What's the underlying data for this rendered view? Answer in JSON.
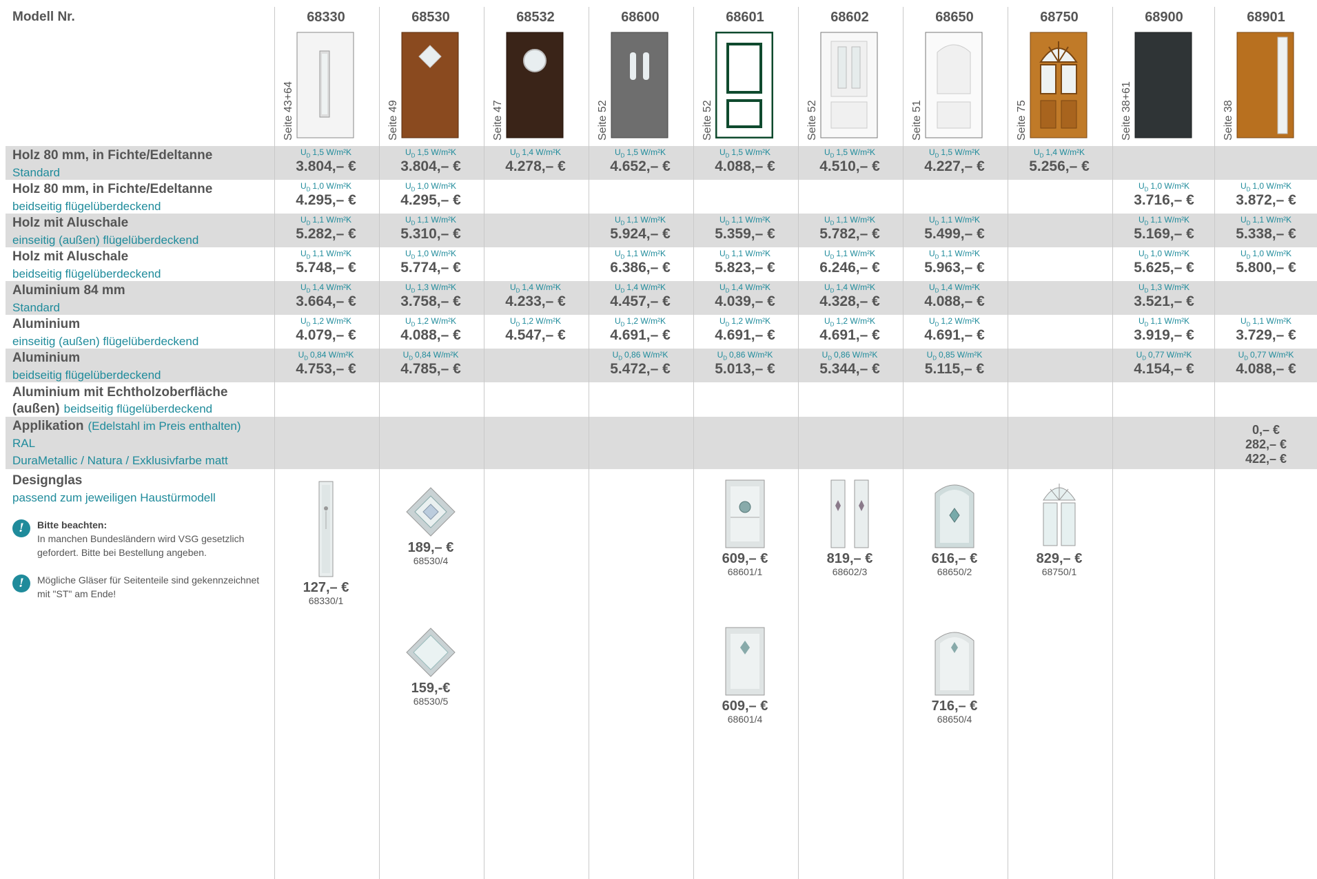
{
  "header": {
    "label": "Modell Nr.",
    "models": [
      {
        "no": "68330",
        "seite": "Seite 43+64",
        "door": "white-slim-glass"
      },
      {
        "no": "68530",
        "seite": "Seite 49",
        "door": "brown-diamond"
      },
      {
        "no": "68532",
        "seite": "Seite 47",
        "door": "darkbrown-round"
      },
      {
        "no": "68600",
        "seite": "Seite 52",
        "door": "grey-two-slots"
      },
      {
        "no": "68601",
        "seite": "Seite 52",
        "door": "green-frame-panels"
      },
      {
        "no": "68602",
        "seite": "Seite 52",
        "door": "white-panels"
      },
      {
        "no": "68650",
        "seite": "Seite 51",
        "door": "white-arch"
      },
      {
        "no": "68750",
        "seite": "Seite 75",
        "door": "wood-sunburst"
      },
      {
        "no": "68900",
        "seite": "Seite 38+61",
        "door": "anthracite"
      },
      {
        "no": "68901",
        "seite": "Seite 38",
        "door": "wood-sidelight"
      }
    ]
  },
  "rows": [
    {
      "title": "Holz 80 mm, in Fichte/Edeltanne",
      "subtitle": "Standard",
      "shaded": true,
      "cells": [
        [
          "1,5 W/m²K",
          "3.804,– €"
        ],
        [
          "1,5 W/m²K",
          "3.804,– €"
        ],
        [
          "1,4 W/m²K",
          "4.278,– €"
        ],
        [
          "1,5 W/m²K",
          "4.652,– €"
        ],
        [
          "1,5 W/m²K",
          "4.088,– €"
        ],
        [
          "1,5 W/m²K",
          "4.510,– €"
        ],
        [
          "1,5 W/m²K",
          "4.227,– €"
        ],
        [
          "1,4 W/m²K",
          "5.256,– €"
        ],
        [
          "",
          ""
        ],
        [
          "",
          ""
        ]
      ]
    },
    {
      "title": "Holz 80 mm, in Fichte/Edeltanne",
      "subtitle": "beidseitig flügelüberdeckend",
      "shaded": false,
      "cells": [
        [
          "1,0 W/m²K",
          "4.295,– €"
        ],
        [
          "1,0 W/m²K",
          "4.295,– €"
        ],
        [
          "",
          ""
        ],
        [
          "",
          ""
        ],
        [
          "",
          ""
        ],
        [
          "",
          ""
        ],
        [
          "",
          ""
        ],
        [
          "",
          ""
        ],
        [
          "1,0 W/m²K",
          "3.716,– €"
        ],
        [
          "1,0 W/m²K",
          "3.872,– €"
        ]
      ]
    },
    {
      "title": "Holz mit Aluschale",
      "subtitle": "einseitig (außen) flügelüberdeckend",
      "shaded": true,
      "cells": [
        [
          "1,1 W/m²K",
          "5.282,– €"
        ],
        [
          "1,1 W/m²K",
          "5.310,– €"
        ],
        [
          "",
          ""
        ],
        [
          "1,1 W/m²K",
          "5.924,– €"
        ],
        [
          "1,1 W/m²K",
          "5.359,– €"
        ],
        [
          "1,1 W/m²K",
          "5.782,– €"
        ],
        [
          "1,1 W/m²K",
          "5.499,– €"
        ],
        [
          "",
          ""
        ],
        [
          "1,1 W/m²K",
          "5.169,– €"
        ],
        [
          "1,1 W/m²K",
          "5.338,– €"
        ]
      ]
    },
    {
      "title": "Holz mit Aluschale",
      "subtitle": "beidseitig flügelüberdeckend",
      "shaded": false,
      "cells": [
        [
          "1,1 W/m²K",
          "5.748,– €"
        ],
        [
          "1,0 W/m²K",
          "5.774,– €"
        ],
        [
          "",
          ""
        ],
        [
          "1,1 W/m²K",
          "6.386,– €"
        ],
        [
          "1,1 W/m²K",
          "5.823,– €"
        ],
        [
          "1,1 W/m²K",
          "6.246,– €"
        ],
        [
          "1,1 W/m²K",
          "5.963,– €"
        ],
        [
          "",
          ""
        ],
        [
          "1,0 W/m²K",
          "5.625,– €"
        ],
        [
          "1,0 W/m²K",
          "5.800,– €"
        ]
      ]
    },
    {
      "title": "Aluminium 84 mm",
      "subtitle": "Standard",
      "shaded": true,
      "cells": [
        [
          "1,4 W/m²K",
          "3.664,– €"
        ],
        [
          "1,3 W/m²K",
          "3.758,– €"
        ],
        [
          "1,4 W/m²K",
          "4.233,– €"
        ],
        [
          "1,4 W/m²K",
          "4.457,– €"
        ],
        [
          "1,4 W/m²K",
          "4.039,– €"
        ],
        [
          "1,4 W/m²K",
          "4.328,– €"
        ],
        [
          "1,4 W/m²K",
          "4.088,– €"
        ],
        [
          "",
          ""
        ],
        [
          "1,3 W/m²K",
          "3.521,– €"
        ],
        [
          "",
          ""
        ]
      ]
    },
    {
      "title": "Aluminium",
      "subtitle": "einseitig (außen) flügelüberdeckend",
      "shaded": false,
      "cells": [
        [
          "1,2 W/m²K",
          "4.079,– €"
        ],
        [
          "1,2 W/m²K",
          "4.088,– €"
        ],
        [
          "1,2 W/m²K",
          "4.547,– €"
        ],
        [
          "1,2 W/m²K",
          "4.691,– €"
        ],
        [
          "1,2 W/m²K",
          "4.691,– €"
        ],
        [
          "1,2 W/m²K",
          "4.691,– €"
        ],
        [
          "1,2 W/m²K",
          "4.691,– €"
        ],
        [
          "",
          ""
        ],
        [
          "1,1 W/m²K",
          "3.919,– €"
        ],
        [
          "1,1 W/m²K",
          "3.729,– €"
        ]
      ]
    },
    {
      "title": "Aluminium",
      "subtitle": "beidseitig flügelüberdeckend",
      "shaded": true,
      "cells": [
        [
          "0,84 W/m²K",
          "4.753,– €"
        ],
        [
          "0,84 W/m²K",
          "4.785,– €"
        ],
        [
          "",
          ""
        ],
        [
          "0,86 W/m²K",
          "5.472,– €"
        ],
        [
          "0,86 W/m²K",
          "5.013,– €"
        ],
        [
          "0,86 W/m²K",
          "5.344,– €"
        ],
        [
          "0,85 W/m²K",
          "5.115,– €"
        ],
        [
          "",
          ""
        ],
        [
          "0,77 W/m²K",
          "4.154,– €"
        ],
        [
          "0,77 W/m²K",
          "4.088,– €"
        ]
      ]
    }
  ],
  "echtholz": {
    "title": "Aluminium mit Echtholzoberfläche",
    "title2": "(außen)",
    "inline": "beidseitig flügelüberdeckend"
  },
  "applikation": {
    "title": "Applikation",
    "inline": "(Edelstahl im Preis enthalten)",
    "line2": "RAL",
    "line3": "DuraMetallic / Natura / Exklusivfarbe matt",
    "prices": [
      "0,– €",
      "282,– €",
      "422,– €"
    ]
  },
  "designglas": {
    "title": "Designglas",
    "subtitle": "passend zum jeweiligen Haustürmodell",
    "items": [
      {
        "price": "127,– €",
        "code": "68330/1"
      },
      {
        "price": "189,– €",
        "code": "68530/4"
      },
      {
        "price": "159,-€",
        "code": "68530/5"
      },
      {
        "price": "609,– €",
        "code": "68601/1"
      },
      {
        "price": "609,– €",
        "code": "68601/4"
      },
      {
        "price": "819,– €",
        "code": "68602/3"
      },
      {
        "price": "616,– €",
        "code": "68650/2"
      },
      {
        "price": "716,– €",
        "code": "68650/4"
      },
      {
        "price": "829,– €",
        "code": "68750/1"
      }
    ]
  },
  "notes": [
    {
      "title": "Bitte beachten:",
      "text": "In manchen Bundesländern wird VSG gesetzlich gefordert. Bitte bei Bestellung angeben."
    },
    {
      "title": "",
      "text": "Mögliche Gläser für Seitenteile sind gekennzeichnet mit \"ST\" am Ende!"
    }
  ],
  "ud_prefix": "U",
  "ud_sub": "D",
  "colors": {
    "accent": "#1f8b9b",
    "band": "#dcdcdc",
    "text": "#555555"
  }
}
